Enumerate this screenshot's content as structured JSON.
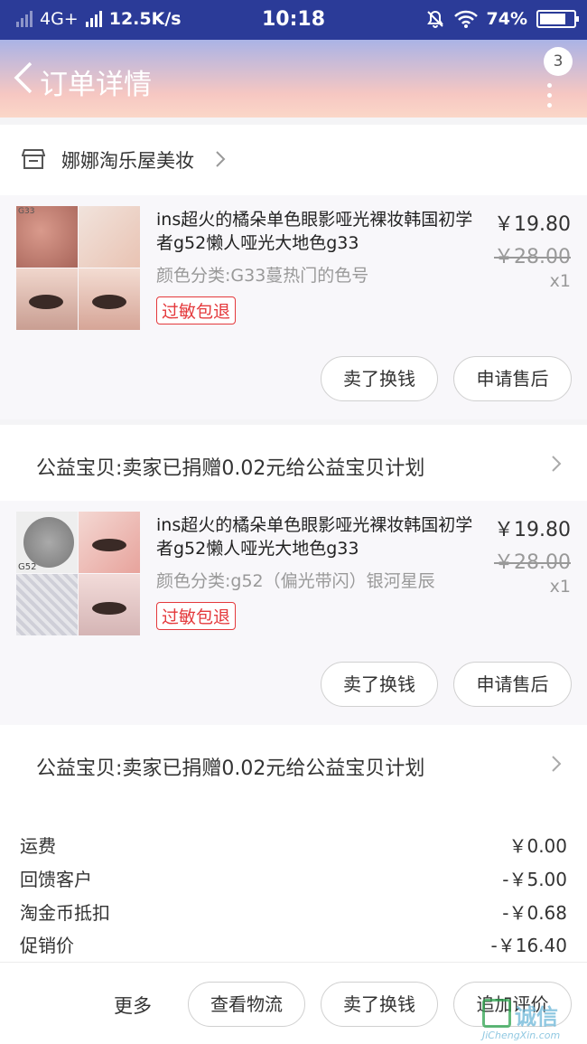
{
  "status_bar": {
    "network": "4G+",
    "speed": "12.5K/s",
    "time": "10:18",
    "battery": "74%"
  },
  "header": {
    "title": "订单详情",
    "badge": "3"
  },
  "shop": {
    "name": "娜娜淘乐屋美妆"
  },
  "items": [
    {
      "title": "ins超火的橘朵单色眼影哑光裸妆韩国初学者g52懒人哑光大地色g33",
      "sku": "颜色分类:G33蔓热门的色号",
      "tag": "过敏包退",
      "price": "￥19.80",
      "original_price": "￥28.00",
      "quantity": "x1",
      "thumb_caption": "G33",
      "buttons": [
        "卖了换钱",
        "申请售后"
      ]
    },
    {
      "title": "ins超火的橘朵单色眼影哑光裸妆韩国初学者g52懒人哑光大地色g33",
      "sku": "颜色分类:g52（偏光带闪）银河星辰",
      "tag": "过敏包退",
      "price": "￥19.80",
      "original_price": "￥28.00",
      "quantity": "x1",
      "thumb_caption": "G52",
      "buttons": [
        "卖了换钱",
        "申请售后"
      ]
    }
  ],
  "charity": "公益宝贝:卖家已捐赠0.02元给公益宝贝计划",
  "summary": [
    {
      "label": "运费",
      "value": "￥0.00"
    },
    {
      "label": "回馈客户",
      "value": "-￥5.00"
    },
    {
      "label": "淘金币抵扣",
      "value": "-￥0.68"
    },
    {
      "label": "促销价",
      "value": "-￥16.40"
    }
  ],
  "bottom_bar": {
    "more": "更多",
    "buttons": [
      "查看物流",
      "卖了换钱",
      "追加评价"
    ]
  },
  "watermark": {
    "brand": "诚信",
    "url": "JiChengXin.com"
  },
  "colors": {
    "status_bar": "#2b3b98",
    "header_top": "#aab3e6",
    "header_bottom": "#fbd7c8",
    "tag_red": "#e4393c"
  }
}
